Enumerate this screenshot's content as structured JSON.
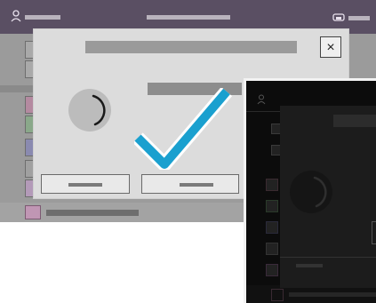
{
  "screens": {
    "main": {
      "topbar": {
        "user_icon": "user-icon",
        "print_icon": "printer-icon"
      },
      "dialog": {
        "close_glyph": "×",
        "confirm_icon": "checkmark-icon"
      },
      "sidebar_icons": [
        "copy-icon",
        "document-icon",
        "fax-icon",
        "scan-icon",
        "email-icon",
        "folder-icon",
        "list-icon",
        "apps-icon",
        "settings-icon"
      ]
    },
    "secondary": {
      "user_icon": "user-icon"
    }
  },
  "colors": {
    "topbar": "#5a4f63",
    "accent_check": "#1aa0cf",
    "dialog_bg": "#dcdcdc"
  }
}
